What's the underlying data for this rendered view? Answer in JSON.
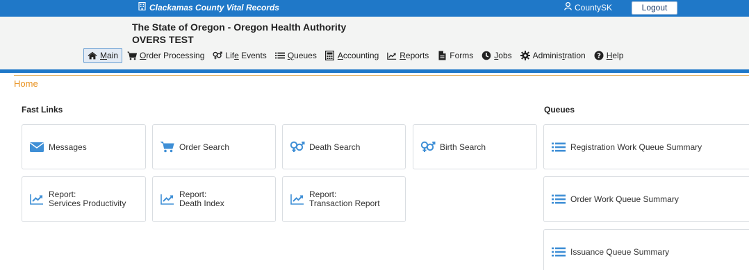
{
  "topbar": {
    "county_title": "Clackamas County Vital Records",
    "username": "CountySK",
    "logout_label": "Logout"
  },
  "header": {
    "state_title": "The State of Oregon - Oregon Health Authority",
    "environment": "OVERS TEST"
  },
  "nav": [
    {
      "label_pre": "",
      "label_u": "M",
      "label_post": "ain",
      "icon": "home-icon"
    },
    {
      "label_pre": "",
      "label_u": "O",
      "label_post": "rder Processing",
      "icon": "cart-icon"
    },
    {
      "label_pre": "Lif",
      "label_u": "e",
      "label_post": " Events",
      "icon": "gender-icon"
    },
    {
      "label_pre": "",
      "label_u": "Q",
      "label_post": "ueues",
      "icon": "list-icon"
    },
    {
      "label_pre": "",
      "label_u": "A",
      "label_post": "ccounting",
      "icon": "calculator-icon"
    },
    {
      "label_pre": "",
      "label_u": "R",
      "label_post": "eports",
      "icon": "chart-icon"
    },
    {
      "label_pre": "Forms",
      "label_u": "",
      "label_post": "",
      "icon": "file-icon"
    },
    {
      "label_pre": "",
      "label_u": "J",
      "label_post": "obs",
      "icon": "clock-icon"
    },
    {
      "label_pre": "Adminis",
      "label_u": "t",
      "label_post": "ration",
      "icon": "gear-icon"
    },
    {
      "label_pre": "",
      "label_u": "H",
      "label_post": "elp",
      "icon": "help-icon"
    }
  ],
  "breadcrumb": "Home",
  "fast_links": {
    "heading": "Fast Links",
    "items": [
      {
        "line1": "Messages",
        "line2": "",
        "icon": "envelope-icon"
      },
      {
        "line1": "Order Search",
        "line2": "",
        "icon": "cart-icon"
      },
      {
        "line1": "Death Search",
        "line2": "",
        "icon": "gender-icon"
      },
      {
        "line1": "Birth Search",
        "line2": "",
        "icon": "gender-icon"
      },
      {
        "line1": "Report:",
        "line2": "Services Productivity",
        "icon": "chart-icon"
      },
      {
        "line1": "Report:",
        "line2": "Death Index",
        "icon": "chart-icon"
      },
      {
        "line1": "Report:",
        "line2": "Transaction Report",
        "icon": "chart-icon"
      }
    ]
  },
  "queues": {
    "heading": "Queues",
    "items": [
      {
        "label": "Registration Work Queue Summary",
        "icon": "list-icon"
      },
      {
        "label": "Order Work Queue Summary",
        "icon": "list-icon"
      },
      {
        "label": "Issuance Queue Summary",
        "icon": "list-icon"
      }
    ]
  },
  "colors": {
    "brand_blue": "#1f78c8",
    "icon_blue": "#3f8fd6",
    "home_orange": "#e8911f"
  }
}
